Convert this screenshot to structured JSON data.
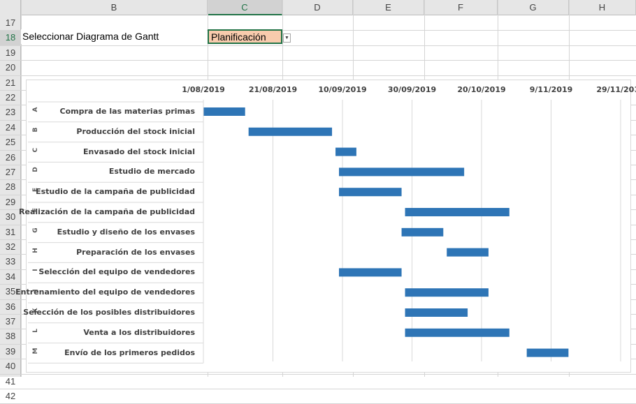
{
  "columns": [
    {
      "name": "",
      "w": 0
    },
    {
      "name": "B"
    },
    {
      "name": "C"
    },
    {
      "name": "D"
    },
    {
      "name": "E"
    },
    {
      "name": "F"
    },
    {
      "name": "G"
    },
    {
      "name": "H"
    }
  ],
  "rows": [
    "17",
    "18",
    "19",
    "20",
    "21",
    "22",
    "23",
    "24",
    "25",
    "26",
    "27",
    "28",
    "29",
    "30",
    "31",
    "32",
    "33",
    "34",
    "35",
    "36",
    "37",
    "38",
    "39",
    "40",
    "41",
    "42"
  ],
  "selected_column": "C",
  "selected_row": "18",
  "cell_b18": "Seleccionar Diagrama de Gantt",
  "cell_c18": "Planificación",
  "chart_data": {
    "type": "bar",
    "subtype": "gantt",
    "x_axis": {
      "ticks": [
        "1/08/2019",
        "21/08/2019",
        "10/09/2019",
        "30/09/2019",
        "20/10/2019",
        "9/11/2019",
        "29/11/2019"
      ],
      "range": [
        "2019-08-01",
        "2019-11-29"
      ],
      "position": "top",
      "gridlines": true
    },
    "tasks": [
      {
        "letter": "A",
        "name": "Compra de las materias primas",
        "start": "2019-08-01",
        "end": "2019-08-13"
      },
      {
        "letter": "B",
        "name": "Producción del stock inicial",
        "start": "2019-08-14",
        "end": "2019-09-07"
      },
      {
        "letter": "C",
        "name": "Envasado del stock inicial",
        "start": "2019-09-08",
        "end": "2019-09-14"
      },
      {
        "letter": "D",
        "name": "Estudio de mercado",
        "start": "2019-09-09",
        "end": "2019-10-15"
      },
      {
        "letter": "E",
        "name": "Estudio de la campaña de publicidad",
        "start": "2019-09-09",
        "end": "2019-09-27"
      },
      {
        "letter": "F",
        "name": "Realización de la campaña de publicidad",
        "start": "2019-09-28",
        "end": "2019-10-28"
      },
      {
        "letter": "G",
        "name": "Estudio y diseño de los envases",
        "start": "2019-09-27",
        "end": "2019-10-09"
      },
      {
        "letter": "H",
        "name": "Preparación de los envases",
        "start": "2019-10-10",
        "end": "2019-10-22"
      },
      {
        "letter": "I",
        "name": "Selección del equipo de vendedores",
        "start": "2019-09-09",
        "end": "2019-09-27"
      },
      {
        "letter": "J",
        "name": "Entrenamiento del equipo de vendedores",
        "start": "2019-09-28",
        "end": "2019-10-22"
      },
      {
        "letter": "K",
        "name": "Selección de los posibles distribuidores",
        "start": "2019-09-28",
        "end": "2019-10-16"
      },
      {
        "letter": "L",
        "name": "Venta a los distribuidores",
        "start": "2019-09-28",
        "end": "2019-10-28"
      },
      {
        "letter": "M",
        "name": "Envío de los primeros pedidos",
        "start": "2019-11-02",
        "end": "2019-11-14"
      }
    ],
    "bar_color": "#2e75b6"
  }
}
